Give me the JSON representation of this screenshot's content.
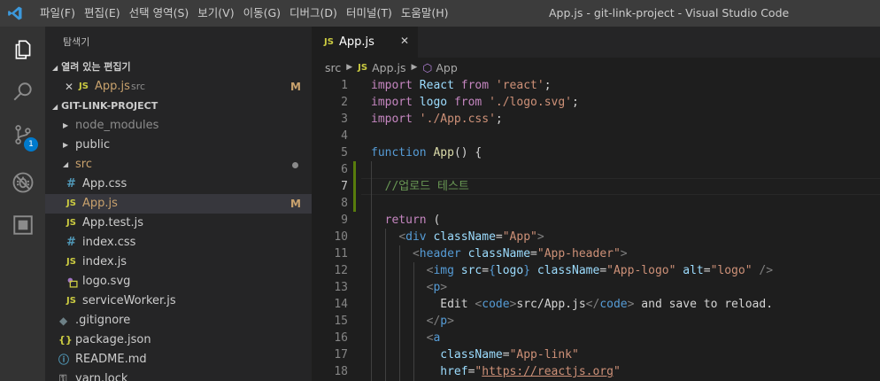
{
  "titlebar": {
    "menu": [
      "파일(F)",
      "편집(E)",
      "선택 영역(S)",
      "보기(V)",
      "이동(G)",
      "디버그(D)",
      "터미널(T)",
      "도움말(H)"
    ],
    "window_title": "App.js - git-link-project - Visual Studio Code"
  },
  "activitybar": {
    "icons": [
      "explorer-icon",
      "search-icon",
      "source-control-icon",
      "debug-icon",
      "extensions-icon"
    ],
    "scm_badge": "1"
  },
  "sidebar": {
    "title": "탐색기",
    "open_editors": {
      "header": "열려 있는 편집기",
      "items": [
        {
          "name": "App.js",
          "folder": "src",
          "status": "M"
        }
      ]
    },
    "project": {
      "header": "GIT-LINK-PROJECT",
      "items": [
        {
          "name": "node_modules",
          "kind": "folder",
          "state": "collapsed"
        },
        {
          "name": "public",
          "kind": "folder",
          "state": "collapsed"
        },
        {
          "name": "src",
          "kind": "folder",
          "state": "expanded"
        },
        {
          "name": "App.css",
          "kind": "css"
        },
        {
          "name": "App.js",
          "kind": "js",
          "status": "M"
        },
        {
          "name": "App.test.js",
          "kind": "js"
        },
        {
          "name": "index.css",
          "kind": "css"
        },
        {
          "name": "index.js",
          "kind": "js"
        },
        {
          "name": "logo.svg",
          "kind": "svg"
        },
        {
          "name": "serviceWorker.js",
          "kind": "js"
        },
        {
          "name": ".gitignore",
          "kind": "git"
        },
        {
          "name": "package.json",
          "kind": "json"
        },
        {
          "name": "README.md",
          "kind": "info"
        },
        {
          "name": "yarn.lock",
          "kind": "lock"
        }
      ]
    }
  },
  "editor": {
    "tab": {
      "label": "App.js",
      "icon": "JS"
    },
    "breadcrumb": [
      "src",
      "App.js",
      "App"
    ],
    "line_numbers": [
      "1",
      "2",
      "3",
      "4",
      "5",
      "6",
      "7",
      "8",
      "9",
      "10",
      "11",
      "12",
      "13",
      "14",
      "15",
      "16",
      "17",
      "18"
    ],
    "active_line": "7",
    "lines": [
      "import React from 'react';",
      "import logo from './logo.svg';",
      "import './App.css';",
      "",
      "function App() {",
      "",
      "  //업로드 테스트",
      "",
      "  return (",
      "    <div className=\"App\">",
      "      <header className=\"App-header\">",
      "        <img src={logo} className=\"App-logo\" alt=\"logo\" />",
      "        <p>",
      "          Edit <code>src/App.js</code> and save to reload.",
      "        </p>",
      "        <a",
      "          className=\"App-link\"",
      "          href=\"https://reactjs.org\""
    ]
  },
  "colors": {
    "titlebar_bg": "#3c3c3c",
    "activitybar_bg": "#333333",
    "sidebar_bg": "#252526",
    "editor_bg": "#1e1e1e",
    "badge_blue": "#007acc",
    "modified_orange": "#c9a26d",
    "gutter_added_green": "#587c0c"
  }
}
